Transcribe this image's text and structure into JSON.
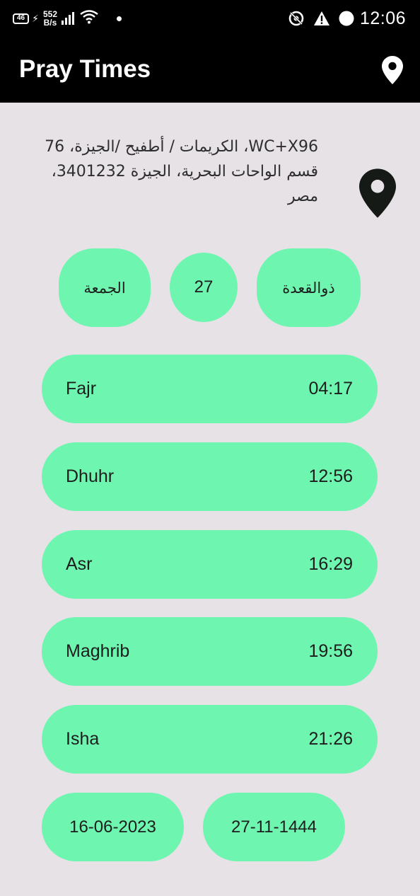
{
  "status_bar": {
    "network_badge": "46",
    "speed_value": "552",
    "speed_unit": "B/s",
    "time": "12:06",
    "icons": [
      "charging-bolt-icon",
      "signal-icon",
      "wifi-icon",
      "notification-dot-icon",
      "data-saver-icon",
      "alert-icon",
      "circle-icon"
    ]
  },
  "app_bar": {
    "title": "Pray Times",
    "location_icon": "location-pin-icon"
  },
  "location": {
    "address": "WC+X96، الكريمات / أطفيح /الجيزة، 76 قسم الواحات البحرية، الجيزة 3401232، مصر",
    "icon": "location-pin-icon"
  },
  "hijri": {
    "day_name": "الجمعة",
    "day_number": "27",
    "month_name": "ذوالقعدة"
  },
  "prayers": [
    {
      "name": "Fajr",
      "time": "04:17"
    },
    {
      "name": "Dhuhr",
      "time": "12:56"
    },
    {
      "name": "Asr",
      "time": "16:29"
    },
    {
      "name": "Maghrib",
      "time": "19:56"
    },
    {
      "name": "Isha",
      "time": "21:26"
    }
  ],
  "dates": {
    "gregorian": "16-06-2023",
    "hijri": "27-11-1444"
  },
  "colors": {
    "accent": "#6ef5b0",
    "background": "#e6e2e6",
    "bar": "#000000"
  }
}
